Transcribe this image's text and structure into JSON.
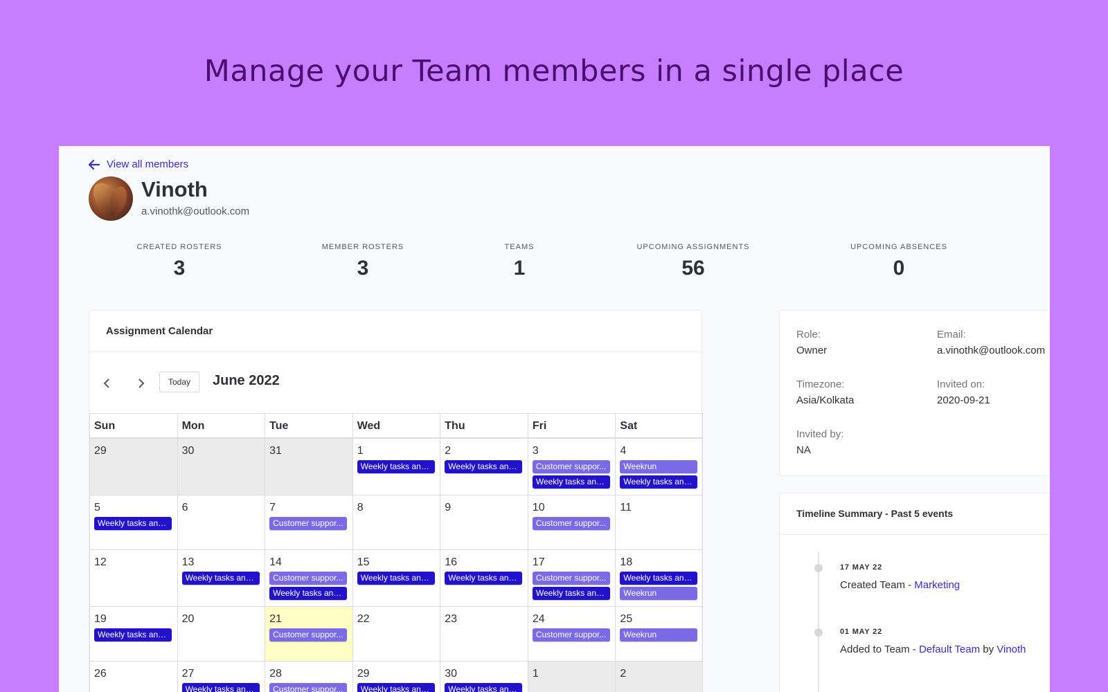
{
  "hero": {
    "title": "Manage your Team members in a single place"
  },
  "member": {
    "back_label": "View all members",
    "name": "Vinoth",
    "email": "a.vinothk@outlook.com"
  },
  "stats": [
    {
      "label": "CREATED ROSTERS",
      "value": "3"
    },
    {
      "label": "MEMBER ROSTERS",
      "value": "3"
    },
    {
      "label": "TEAMS",
      "value": "1"
    },
    {
      "label": "UPCOMING ASSIGNMENTS",
      "value": "56"
    },
    {
      "label": "UPCOMING ABSENCES",
      "value": "0"
    }
  ],
  "calendar": {
    "title": "Assignment Calendar",
    "today_label": "Today",
    "month": "June 2022",
    "days_of_week": [
      "Sun",
      "Mon",
      "Tue",
      "Wed",
      "Thu",
      "Fri",
      "Sat"
    ],
    "weeks": [
      [
        {
          "n": "29",
          "other": true,
          "events": []
        },
        {
          "n": "30",
          "other": true,
          "events": []
        },
        {
          "n": "31",
          "other": true,
          "events": []
        },
        {
          "n": "1",
          "events": [
            {
              "t": "Weekly tasks anc...",
              "c": "dark"
            }
          ]
        },
        {
          "n": "2",
          "events": [
            {
              "t": "Weekly tasks anc...",
              "c": "dark"
            }
          ]
        },
        {
          "n": "3",
          "events": [
            {
              "t": "Customer suppor...",
              "c": "light"
            },
            {
              "t": "Weekly tasks anc...",
              "c": "dark"
            }
          ]
        },
        {
          "n": "4",
          "events": [
            {
              "t": "Weekrun",
              "c": "light"
            },
            {
              "t": "Weekly tasks anc...",
              "c": "dark"
            }
          ]
        }
      ],
      [
        {
          "n": "5",
          "events": [
            {
              "t": "Weekly tasks anc...",
              "c": "dark"
            }
          ]
        },
        {
          "n": "6",
          "events": []
        },
        {
          "n": "7",
          "events": [
            {
              "t": "Customer suppor...",
              "c": "light"
            }
          ]
        },
        {
          "n": "8",
          "events": []
        },
        {
          "n": "9",
          "events": []
        },
        {
          "n": "10",
          "events": [
            {
              "t": "Customer suppor...",
              "c": "light"
            }
          ]
        },
        {
          "n": "11",
          "events": []
        }
      ],
      [
        {
          "n": "12",
          "events": []
        },
        {
          "n": "13",
          "events": [
            {
              "t": "Weekly tasks anc...",
              "c": "dark"
            }
          ]
        },
        {
          "n": "14",
          "events": [
            {
              "t": "Customer suppor...",
              "c": "light"
            },
            {
              "t": "Weekly tasks anc...",
              "c": "dark"
            }
          ]
        },
        {
          "n": "15",
          "events": [
            {
              "t": "Weekly tasks anc...",
              "c": "dark"
            }
          ]
        },
        {
          "n": "16",
          "events": [
            {
              "t": "Weekly tasks anc...",
              "c": "dark"
            }
          ]
        },
        {
          "n": "17",
          "events": [
            {
              "t": "Customer suppor...",
              "c": "light"
            },
            {
              "t": "Weekly tasks anc...",
              "c": "dark"
            }
          ]
        },
        {
          "n": "18",
          "events": [
            {
              "t": "Weekly tasks anc...",
              "c": "dark"
            },
            {
              "t": "Weekrun",
              "c": "light"
            }
          ]
        }
      ],
      [
        {
          "n": "19",
          "events": [
            {
              "t": "Weekly tasks anc...",
              "c": "dark"
            }
          ]
        },
        {
          "n": "20",
          "events": []
        },
        {
          "n": "21",
          "today": true,
          "events": [
            {
              "t": "Customer suppor...",
              "c": "light"
            }
          ]
        },
        {
          "n": "22",
          "events": []
        },
        {
          "n": "23",
          "events": []
        },
        {
          "n": "24",
          "events": [
            {
              "t": "Customer suppor...",
              "c": "light"
            }
          ]
        },
        {
          "n": "25",
          "events": [
            {
              "t": "Weekrun",
              "c": "light"
            }
          ]
        }
      ],
      [
        {
          "n": "26",
          "events": []
        },
        {
          "n": "27",
          "events": [
            {
              "t": "Weekly tasks anc...",
              "c": "dark"
            }
          ]
        },
        {
          "n": "28",
          "events": [
            {
              "t": "Customer suppor...",
              "c": "light"
            }
          ]
        },
        {
          "n": "29",
          "events": [
            {
              "t": "Weekly tasks anc...",
              "c": "dark"
            }
          ]
        },
        {
          "n": "30",
          "events": [
            {
              "t": "Weekly tasks anc...",
              "c": "dark"
            }
          ]
        },
        {
          "n": "1",
          "other": true,
          "events": []
        },
        {
          "n": "2",
          "other": true,
          "events": []
        }
      ]
    ]
  },
  "info": {
    "role_label": "Role:",
    "role": "Owner",
    "email_label": "Email:",
    "email": "a.vinothk@outlook.com",
    "timezone_label": "Timezone:",
    "timezone": "Asia/Kolkata",
    "invited_on_label": "Invited on:",
    "invited_on": "2020-09-21",
    "invited_by_label": "Invited by:",
    "invited_by": "NA"
  },
  "timeline": {
    "title": "Timeline Summary - Past 5 events",
    "events": [
      {
        "date": "17 MAY 22",
        "prefix": "Created Team - ",
        "link": "Marketing"
      },
      {
        "date": "01 MAY 22",
        "prefix": "Added to Team - ",
        "link": "Default Team",
        "middle": " by ",
        "link2": "Vinoth"
      }
    ]
  },
  "colors": {
    "accent": "#3b2bd6",
    "event_dark": "#2212cc",
    "event_light": "#7a6ae6",
    "hero_bg": "#c77dff",
    "today_bg": "#ffffc5"
  }
}
